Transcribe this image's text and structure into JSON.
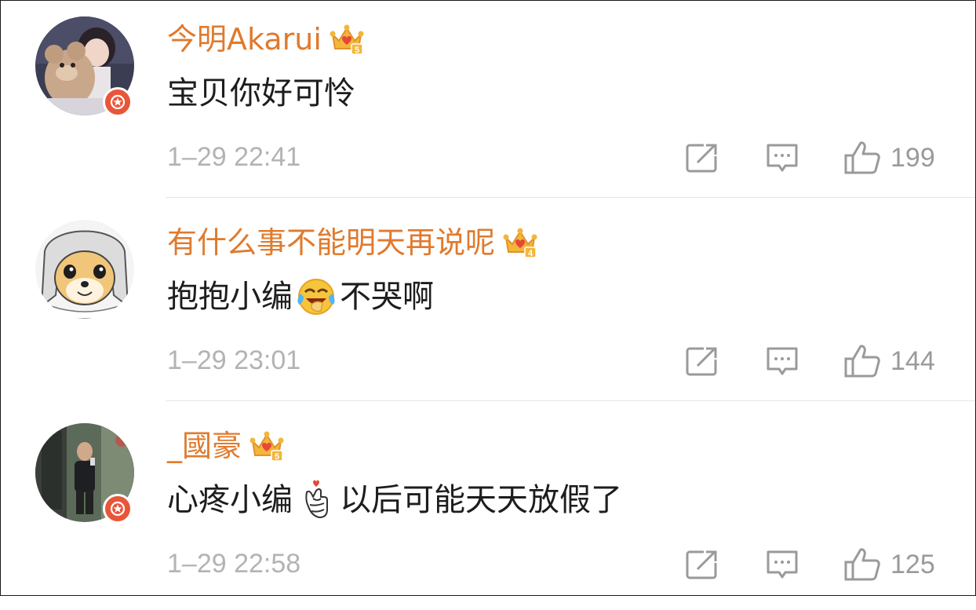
{
  "comments": [
    {
      "username": "今明Akarui",
      "crown_level": "5",
      "content_parts": [
        "宝贝你好可怜"
      ],
      "time": "1–29 22:41",
      "likes": "199",
      "verified": true
    },
    {
      "username": "有什么事不能明天再说呢",
      "crown_level": "4",
      "content_parts": [
        "抱抱小编",
        "不哭啊"
      ],
      "emoji": "laugh-cry-emoji",
      "time": "1–29 23:01",
      "likes": "144",
      "verified": false
    },
    {
      "username": "_國豪",
      "crown_level": "5",
      "content_parts": [
        "心疼小编",
        "以后可能天天放假了"
      ],
      "emoji": "finger-heart-emoji",
      "time": "1–29 22:58",
      "likes": "125",
      "verified": true
    }
  ],
  "colors": {
    "username": "#e07a2d",
    "text": "#1d1d1d",
    "meta": "#b3b3b3",
    "badge": "#e8563a",
    "crown": "#f3b63a"
  },
  "icons": {
    "repost": "repost-icon",
    "reply": "reply-icon",
    "like": "thumbs-up-icon",
    "crown": "crown-icon",
    "verified": "verified-badge-icon"
  }
}
